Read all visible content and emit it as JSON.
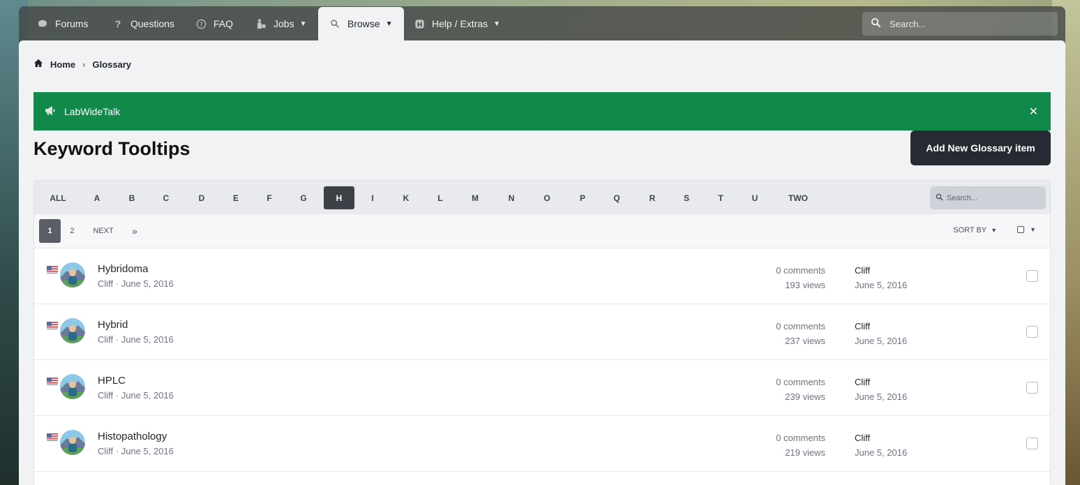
{
  "nav": {
    "items": [
      {
        "label": "Forums",
        "icon": "speech-bubble-icon"
      },
      {
        "label": "Questions",
        "icon": "question-icon"
      },
      {
        "label": "FAQ",
        "icon": "question-circle-icon"
      },
      {
        "label": "Jobs",
        "icon": "jobs-icon",
        "dropdown": true
      },
      {
        "label": "Browse",
        "icon": "search-icon",
        "dropdown": true,
        "active": true
      },
      {
        "label": "Help / Extras",
        "icon": "help-box-icon",
        "dropdown": true
      }
    ],
    "search_placeholder": "Search..."
  },
  "breadcrumb": {
    "home": "Home",
    "current": "Glossary"
  },
  "announcement": {
    "text": "LabWideTalk",
    "icon": "megaphone-icon"
  },
  "page_title": "Keyword Tooltips",
  "add_button": "Add New Glossary item",
  "letters": [
    "ALL",
    "A",
    "B",
    "C",
    "D",
    "E",
    "F",
    "G",
    "H",
    "I",
    "K",
    "L",
    "M",
    "N",
    "O",
    "P",
    "Q",
    "R",
    "S",
    "T",
    "U",
    "TWO"
  ],
  "active_letter": "H",
  "filter_search_placeholder": "Search...",
  "pager": {
    "pages": [
      "1",
      "2"
    ],
    "next": "NEXT",
    "last_icon": "double-chevron-right-icon",
    "sort_label": "SORT BY"
  },
  "rows": [
    {
      "title": "Hybridoma",
      "meta": "Cliff · June 5, 2016",
      "comments": "0 comments",
      "views": "193 views",
      "last_author": "Cliff",
      "last_date": "June 5, 2016"
    },
    {
      "title": "Hybrid",
      "meta": "Cliff · June 5, 2016",
      "comments": "0 comments",
      "views": "237 views",
      "last_author": "Cliff",
      "last_date": "June 5, 2016"
    },
    {
      "title": "HPLC",
      "meta": "Cliff · June 5, 2016",
      "comments": "0 comments",
      "views": "239 views",
      "last_author": "Cliff",
      "last_date": "June 5, 2016"
    },
    {
      "title": "Histopathology",
      "meta": "Cliff · June 5, 2016",
      "comments": "0 comments",
      "views": "219 views",
      "last_author": "Cliff",
      "last_date": "June 5, 2016"
    }
  ]
}
